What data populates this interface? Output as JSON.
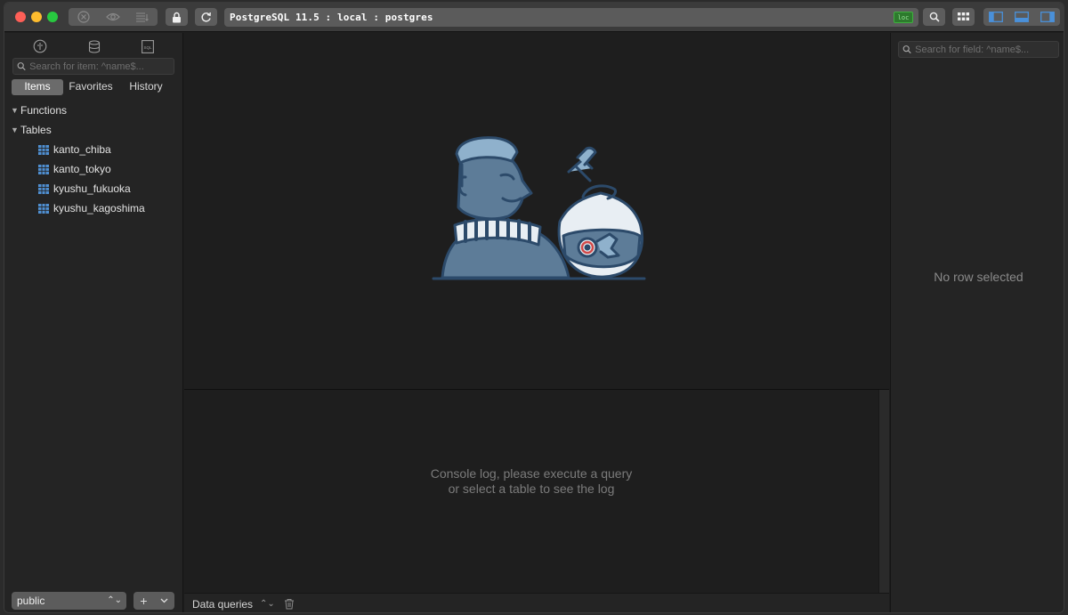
{
  "titlebar": {
    "connection": "PostgreSQL 11.5 : local : postgres",
    "badge": "loc"
  },
  "icons": {
    "close_query": "x-circle-icon",
    "preview": "eye-icon",
    "lines": "list-icon",
    "lock": "lock-icon",
    "refresh": "refresh-icon",
    "search": "search-icon",
    "grid": "grid-icon",
    "layout_left": "sidebar-left-icon",
    "layout_bottom": "panel-bottom-icon",
    "layout_right": "sidebar-right-icon"
  },
  "sidebar": {
    "search_placeholder": "Search for item: ^name$...",
    "tabs": [
      "Items",
      "Favorites",
      "History"
    ],
    "active_tab": "Items",
    "sections": [
      {
        "label": "Functions",
        "expanded": true,
        "items": []
      },
      {
        "label": "Tables",
        "expanded": true,
        "items": [
          "kanto_chiba",
          "kanto_tokyo",
          "kyushu_fukuoka",
          "kyushu_kagoshima"
        ]
      }
    ],
    "schema": "public",
    "add_label": "+"
  },
  "main": {
    "console_line1": "Console log, please execute a query",
    "console_line2": "or select a table to see the log",
    "bottom_label": "Data queries"
  },
  "rightpanel": {
    "search_placeholder": "Search for field: ^name$...",
    "empty_text": "No row selected"
  },
  "colors": {
    "accent_blue": "#4a90d9",
    "table_icon": "#4f8fd1",
    "illustration_fill": "#5d7c98",
    "illustration_stroke": "#2c4a6a",
    "red": "#fe5f57",
    "yellow": "#febc2e",
    "green": "#28c840"
  }
}
